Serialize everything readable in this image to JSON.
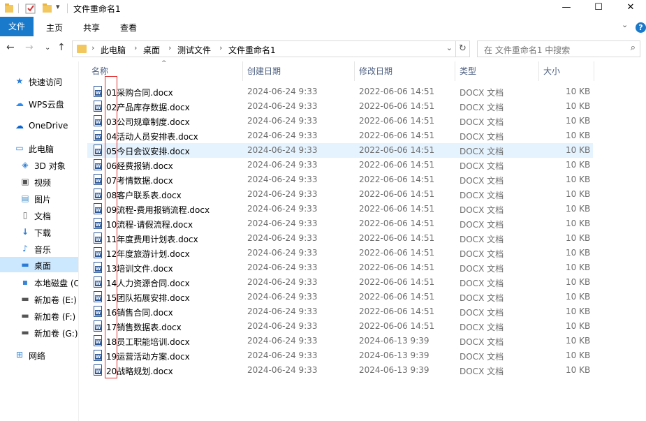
{
  "window": {
    "title": "文件重命名1",
    "controls": {
      "minimize": "—",
      "maximize": "☐",
      "close": "✕"
    }
  },
  "ribbon": {
    "file_tab": "文件",
    "tabs": [
      "主页",
      "共享",
      "查看"
    ],
    "help": "?"
  },
  "nav": {
    "breadcrumbs": [
      "此电脑",
      "桌面",
      "测试文件",
      "文件重命名1"
    ],
    "search_placeholder": "在 文件重命名1 中搜索"
  },
  "sidebar": {
    "items": [
      {
        "label": "快速访问",
        "icon": "star-icon",
        "active": false
      },
      {
        "label": "WPS云盘",
        "icon": "cloud-icon",
        "active": false
      },
      {
        "label": "OneDrive",
        "icon": "onedrive-icon",
        "active": false
      },
      {
        "label": "此电脑",
        "icon": "computer-icon",
        "active": false
      },
      {
        "label": "3D 对象",
        "icon": "cube-icon",
        "active": false
      },
      {
        "label": "视频",
        "icon": "video-icon",
        "active": false
      },
      {
        "label": "图片",
        "icon": "picture-icon",
        "active": false
      },
      {
        "label": "文档",
        "icon": "document-icon",
        "active": false
      },
      {
        "label": "下载",
        "icon": "download-icon",
        "active": false
      },
      {
        "label": "音乐",
        "icon": "music-icon",
        "active": false
      },
      {
        "label": "桌面",
        "icon": "desktop-icon",
        "active": true
      },
      {
        "label": "本地磁盘 (C",
        "icon": "drive-icon",
        "active": false
      },
      {
        "label": "新加卷 (E:)",
        "icon": "drive-icon",
        "active": false
      },
      {
        "label": "新加卷 (F:)",
        "icon": "drive-icon",
        "active": false
      },
      {
        "label": "新加卷 (G:)",
        "icon": "drive-icon",
        "active": false
      },
      {
        "label": "网络",
        "icon": "network-icon",
        "active": false
      }
    ]
  },
  "columns": {
    "name": "名称",
    "created": "创建日期",
    "modified": "修改日期",
    "type": "类型",
    "size": "大小"
  },
  "files": [
    {
      "name": "01采购合同.docx",
      "created": "2024-06-24 9:33",
      "modified": "2022-06-06 14:51",
      "type": "DOCX 文档",
      "size": "10 KB"
    },
    {
      "name": "02产品库存数据.docx",
      "created": "2024-06-24 9:33",
      "modified": "2022-06-06 14:51",
      "type": "DOCX 文档",
      "size": "10 KB"
    },
    {
      "name": "03公司规章制度.docx",
      "created": "2024-06-24 9:33",
      "modified": "2022-06-06 14:51",
      "type": "DOCX 文档",
      "size": "10 KB"
    },
    {
      "name": "04活动人员安排表.docx",
      "created": "2024-06-24 9:33",
      "modified": "2022-06-06 14:51",
      "type": "DOCX 文档",
      "size": "10 KB"
    },
    {
      "name": "05今日会议安排.docx",
      "created": "2024-06-24 9:33",
      "modified": "2022-06-06 14:51",
      "type": "DOCX 文档",
      "size": "10 KB"
    },
    {
      "name": "06经费报销.docx",
      "created": "2024-06-24 9:33",
      "modified": "2022-06-06 14:51",
      "type": "DOCX 文档",
      "size": "10 KB"
    },
    {
      "name": "07考情数据.docx",
      "created": "2024-06-24 9:33",
      "modified": "2022-06-06 14:51",
      "type": "DOCX 文档",
      "size": "10 KB"
    },
    {
      "name": "08客户联系表.docx",
      "created": "2024-06-24 9:33",
      "modified": "2022-06-06 14:51",
      "type": "DOCX 文档",
      "size": "10 KB"
    },
    {
      "name": "09流程-费用报销流程.docx",
      "created": "2024-06-24 9:33",
      "modified": "2022-06-06 14:51",
      "type": "DOCX 文档",
      "size": "10 KB"
    },
    {
      "name": "10流程-请假流程.docx",
      "created": "2024-06-24 9:33",
      "modified": "2022-06-06 14:51",
      "type": "DOCX 文档",
      "size": "10 KB"
    },
    {
      "name": "11年度费用计划表.docx",
      "created": "2024-06-24 9:33",
      "modified": "2022-06-06 14:51",
      "type": "DOCX 文档",
      "size": "10 KB"
    },
    {
      "name": "12年度旅游计划.docx",
      "created": "2024-06-24 9:33",
      "modified": "2022-06-06 14:51",
      "type": "DOCX 文档",
      "size": "10 KB"
    },
    {
      "name": "13培训文件.docx",
      "created": "2024-06-24 9:33",
      "modified": "2022-06-06 14:51",
      "type": "DOCX 文档",
      "size": "10 KB"
    },
    {
      "name": "14人力资源合同.docx",
      "created": "2024-06-24 9:33",
      "modified": "2022-06-06 14:51",
      "type": "DOCX 文档",
      "size": "10 KB"
    },
    {
      "name": "15团队拓展安排.docx",
      "created": "2024-06-24 9:33",
      "modified": "2022-06-06 14:51",
      "type": "DOCX 文档",
      "size": "10 KB"
    },
    {
      "name": "16销售合同.docx",
      "created": "2024-06-24 9:33",
      "modified": "2022-06-06 14:51",
      "type": "DOCX 文档",
      "size": "10 KB"
    },
    {
      "name": "17销售数据表.docx",
      "created": "2024-06-24 9:33",
      "modified": "2022-06-06 14:51",
      "type": "DOCX 文档",
      "size": "10 KB"
    },
    {
      "name": "18员工职能培训.docx",
      "created": "2024-06-24 9:33",
      "modified": "2024-06-13 9:39",
      "type": "DOCX 文档",
      "size": "10 KB"
    },
    {
      "name": "19运营活动方案.docx",
      "created": "2024-06-24 9:33",
      "modified": "2024-06-13 9:39",
      "type": "DOCX 文档",
      "size": "10 KB"
    },
    {
      "name": "20战略规划.docx",
      "created": "2024-06-24 9:33",
      "modified": "2024-06-13 9:39",
      "type": "DOCX 文档",
      "size": "10 KB"
    }
  ],
  "highlighted_row": 4,
  "colors": {
    "accent": "#1979ca",
    "hover_row": "#e5f3ff",
    "selected_nav": "#cce8ff",
    "annotation": "#e03131"
  }
}
